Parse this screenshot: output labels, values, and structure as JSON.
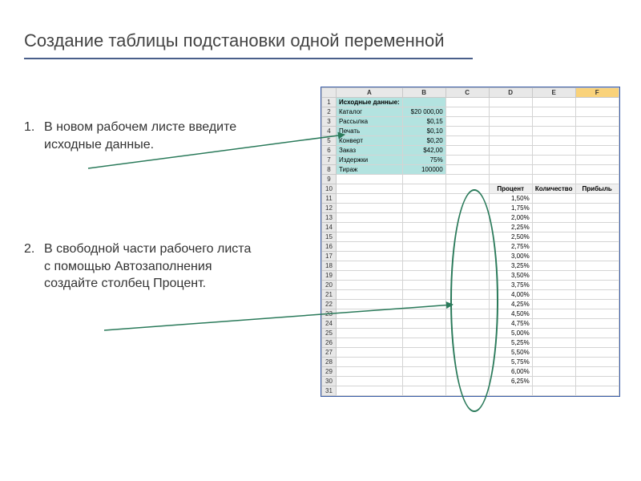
{
  "title": "Создание таблицы подстановки одной переменной",
  "steps": [
    {
      "num": "1.",
      "text": "В новом рабочем листе введите исходные данные."
    },
    {
      "num": "2.",
      "text": "В свободной части рабочего листа с помощью Автозаполнения создайте столбец Процент."
    }
  ],
  "spreadsheet": {
    "columns": [
      "A",
      "B",
      "C",
      "D",
      "E",
      "F"
    ],
    "selected_column": "F",
    "rows": 31,
    "source_header": "Исходные данные:",
    "source_data": [
      {
        "label": "Каталог",
        "value": "$20 000,00"
      },
      {
        "label": "Рассылка",
        "value": "$0,15"
      },
      {
        "label": "Печать",
        "value": "$0,10"
      },
      {
        "label": "Конверт",
        "value": "$0,20"
      },
      {
        "label": "Заказ",
        "value": "$42,00"
      },
      {
        "label": "Издержки",
        "value": "75%"
      },
      {
        "label": "Тираж",
        "value": "100000"
      }
    ],
    "result_headers": {
      "D": "Процент",
      "E": "Количество",
      "F": "Прибыль"
    },
    "result_header_row": 10,
    "percent_column": "D",
    "percent_start_row": 11,
    "percents": [
      "1,50%",
      "1,75%",
      "2,00%",
      "2,25%",
      "2,50%",
      "2,75%",
      "3,00%",
      "3,25%",
      "3,50%",
      "3,75%",
      "4,00%",
      "4,25%",
      "4,50%",
      "4,75%",
      "5,00%",
      "5,25%",
      "5,50%",
      "5,75%",
      "6,00%",
      "6,25%"
    ]
  }
}
